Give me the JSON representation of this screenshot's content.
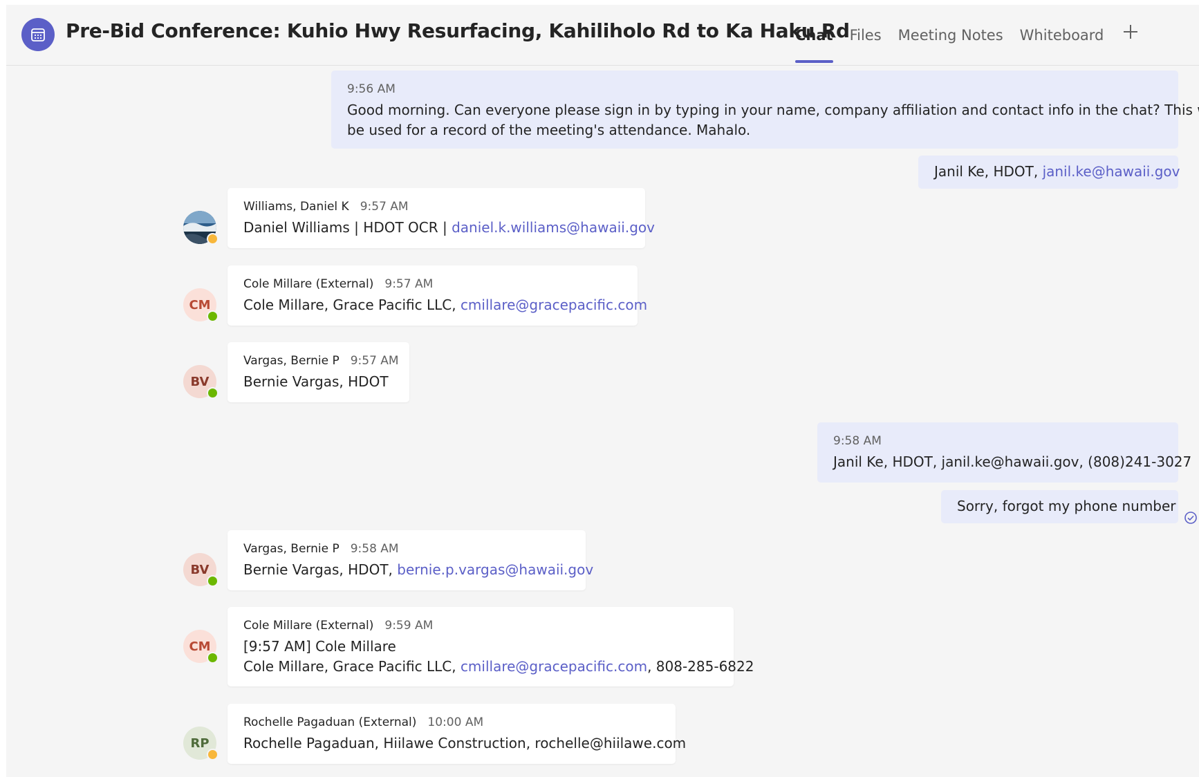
{
  "header": {
    "title": "Pre-Bid Conference: Kuhio Hwy Resurfacing, Kahiliholo Rd to Ka Haku Rd",
    "tabs": [
      {
        "label": "Chat",
        "active": true
      },
      {
        "label": "Files",
        "active": false
      },
      {
        "label": "Meeting Notes",
        "active": false
      },
      {
        "label": "Whiteboard",
        "active": false
      }
    ],
    "add_tab_icon": "plus-icon",
    "meeting_icon": "calendar-icon"
  },
  "colors": {
    "accent": "#5b5fc7",
    "my_bubble": "#e8ebfa",
    "status_available": "#6bb700",
    "status_away": "#f8b73b"
  },
  "messages": [
    {
      "mine": true,
      "time": "9:56 AM",
      "text_line1": "Good morning. Can everyone please sign in by typing in your name, company affiliation and contact info in the chat? This will",
      "text_line2": "be used for a record of the meeting's attendance. Mahalo."
    },
    {
      "mine": true,
      "text": "Janil Ke, HDOT, ",
      "link": "janil.ke@hawaii.gov"
    },
    {
      "mine": false,
      "sender": "Williams, Daniel K",
      "time": "9:57 AM",
      "status": "away",
      "text": "Daniel Williams | HDOT OCR | ",
      "link": "daniel.k.williams@hawaii.gov"
    },
    {
      "mine": false,
      "sender": "Cole Millare (External)",
      "initials": "CM",
      "time": "9:57 AM",
      "status": "available",
      "text": "Cole Millare, Grace Pacific LLC, ",
      "link": "cmillare@gracepacific.com"
    },
    {
      "mine": false,
      "sender": "Vargas, Bernie P",
      "initials": "BV",
      "time": "9:57 AM",
      "status": "available",
      "text": "Bernie Vargas, HDOT"
    },
    {
      "mine": true,
      "time": "9:58 AM",
      "text": "Janil Ke, HDOT, janil.ke@hawaii.gov, (808)241-3027"
    },
    {
      "mine": true,
      "text": "Sorry, forgot my phone number",
      "receipt_icon": "read-receipt-icon"
    },
    {
      "mine": false,
      "sender": "Vargas, Bernie P",
      "initials": "BV",
      "time": "9:58 AM",
      "status": "available",
      "text": "Bernie Vargas, HDOT, ",
      "link": "bernie.p.vargas@hawaii.gov"
    },
    {
      "mine": false,
      "sender": "Cole Millare (External)",
      "initials": "CM",
      "time": "9:59 AM",
      "status": "available",
      "text_line1": "[9:57 AM] Cole Millare",
      "text_line2": "Cole Millare, Grace Pacific LLC, ",
      "link": "cmillare@gracepacific.com",
      "text_suffix": ", 808-285-6822"
    },
    {
      "mine": false,
      "sender": "Rochelle Pagaduan (External)",
      "initials": "RP",
      "time": "10:00 AM",
      "status": "away",
      "text": "Rochelle Pagaduan, Hiilawe Construction, rochelle@hiilawe.com"
    }
  ]
}
